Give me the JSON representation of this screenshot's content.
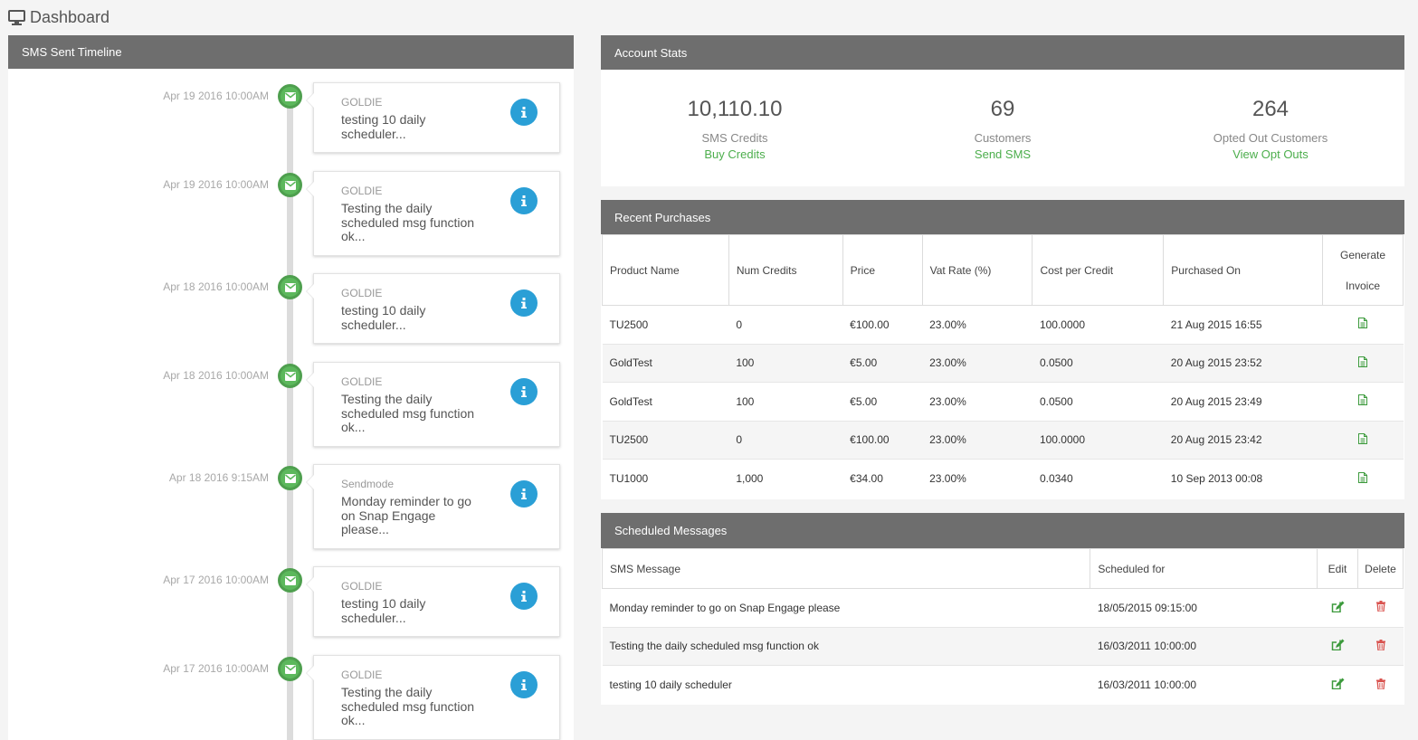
{
  "page": {
    "title": "Dashboard",
    "icon": "monitor-icon"
  },
  "timeline": {
    "title": "SMS Sent Timeline",
    "items": [
      {
        "date": "Apr 19 2016 10:00AM",
        "sender": "GOLDIE",
        "message": "testing 10 daily scheduler..."
      },
      {
        "date": "Apr 19 2016 10:00AM",
        "sender": "GOLDIE",
        "message": "Testing the daily scheduled msg function ok..."
      },
      {
        "date": "Apr 18 2016 10:00AM",
        "sender": "GOLDIE",
        "message": "testing 10 daily scheduler..."
      },
      {
        "date": "Apr 18 2016 10:00AM",
        "sender": "GOLDIE",
        "message": "Testing the daily scheduled msg function ok..."
      },
      {
        "date": "Apr 18 2016 9:15AM",
        "sender": "Sendmode",
        "message": "Monday reminder to go on Snap Engage please..."
      },
      {
        "date": "Apr 17 2016 10:00AM",
        "sender": "GOLDIE",
        "message": "testing 10 daily scheduler..."
      },
      {
        "date": "Apr 17 2016 10:00AM",
        "sender": "GOLDIE",
        "message": "Testing the daily scheduled msg function ok..."
      }
    ]
  },
  "stats": {
    "title": "Account Stats",
    "items": [
      {
        "value": "10,110.10",
        "label": "SMS Credits",
        "link": "Buy Credits"
      },
      {
        "value": "69",
        "label": "Customers",
        "link": "Send SMS"
      },
      {
        "value": "264",
        "label": "Opted Out Customers",
        "link": "View Opt Outs"
      }
    ]
  },
  "purchases": {
    "title": "Recent Purchases",
    "columns": [
      "Product Name",
      "Num Credits",
      "Price",
      "Vat Rate (%)",
      "Cost per Credit",
      "Purchased On"
    ],
    "invoice_header": [
      "Generate",
      "Invoice"
    ],
    "rows": [
      [
        "TU2500",
        "0",
        "€100.00",
        "23.00%",
        "100.0000",
        "21 Aug 2015 16:55"
      ],
      [
        "GoldTest",
        "100",
        "€5.00",
        "23.00%",
        "0.0500",
        "20 Aug 2015 23:52"
      ],
      [
        "GoldTest",
        "100",
        "€5.00",
        "23.00%",
        "0.0500",
        "20 Aug 2015 23:49"
      ],
      [
        "TU2500",
        "0",
        "€100.00",
        "23.00%",
        "100.0000",
        "20 Aug 2015 23:42"
      ],
      [
        "TU1000",
        "1,000",
        "€34.00",
        "23.00%",
        "0.0340",
        "10 Sep 2013 00:08"
      ]
    ]
  },
  "scheduled": {
    "title": "Scheduled Messages",
    "columns": [
      "SMS Message",
      "Scheduled for",
      "Edit",
      "Delete"
    ],
    "rows": [
      [
        "Monday reminder to go on Snap Engage please",
        "18/05/2015 09:15:00"
      ],
      [
        "Testing the daily scheduled msg function ok",
        "16/03/2011 10:00:00"
      ],
      [
        "testing 10 daily scheduler",
        "16/03/2011 10:00:00"
      ]
    ]
  },
  "colors": {
    "header": "#6e6e6e",
    "accent_green": "#5cb85c",
    "info_blue": "#2a9fd6",
    "delete_red": "#d9534f"
  }
}
